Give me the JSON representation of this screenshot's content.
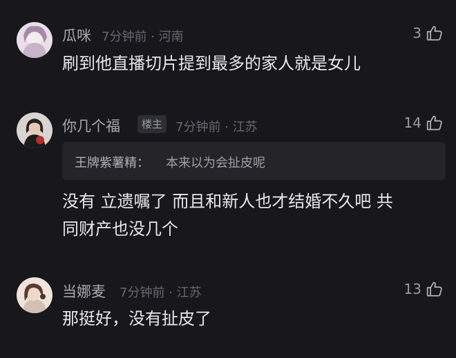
{
  "comments": [
    {
      "username": "瓜咪",
      "meta": "7分钟前 · 河南",
      "likes": "3",
      "text_lines": [
        "刷到他直播切片提到最多的家人就是女儿"
      ],
      "avatar_colors": [
        "#d8c6d6",
        "#a58aa8"
      ]
    },
    {
      "username": "你几个福",
      "badge": "楼主",
      "meta": "7分钟前 · 江苏",
      "likes": "14",
      "quote": {
        "author": "王牌紫薯精：",
        "text": "本来以为会扯皮呢"
      },
      "text_lines": [
        "没有 立遗嘱了 而且和新人也才结婚不久吧 共",
        "同财产也没几个"
      ],
      "avatar_colors": [
        "#2a2020",
        "#b33030"
      ]
    },
    {
      "username": "当娜麦",
      "meta": "7分钟前 · 江苏",
      "likes": "13",
      "text_lines": [
        "那挺好，没有扯皮了"
      ],
      "avatar_colors": [
        "#e6d4c8",
        "#5a3c34"
      ]
    }
  ],
  "icons": {
    "like": "thumbs-up-icon"
  }
}
